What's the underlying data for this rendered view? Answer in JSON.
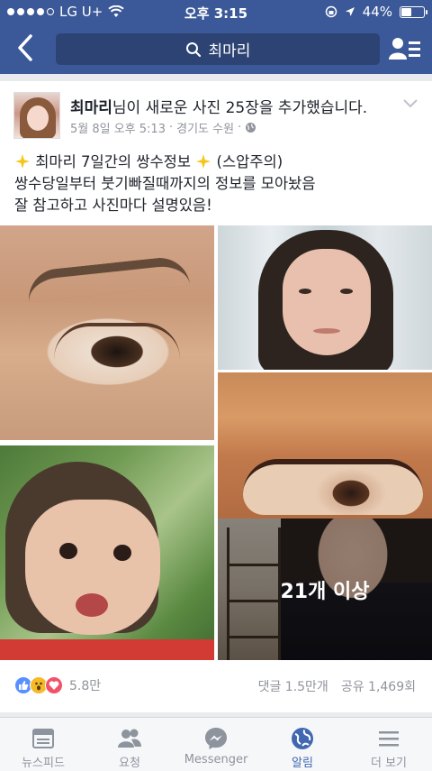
{
  "status_bar": {
    "carrier": "LG U+",
    "time": "오후 3:15",
    "battery": "44%",
    "battery_level": 0.44
  },
  "nav": {
    "search_text": "최마리"
  },
  "post": {
    "author": "최마리",
    "action": "님이 새로운 사진 25장을 추가했습니다.",
    "date": "5월 8일 오후 5:13",
    "location": "경기도 수원",
    "caption_line1_a": "최마리 7일간의 쌍수정보",
    "caption_line1_b": "(스압주의)",
    "caption_line2": "쌍수당일부터 붓기빠질때까지의 정보를 모아놨음",
    "caption_line3": "잘 참고하고 사진마다 설명있음!",
    "more_photos": "21개 이상",
    "reaction_count": "5.8만",
    "comments": "댓글 1.5만개",
    "shares": "공유 1,469회"
  },
  "tabs": [
    {
      "label": "뉴스피드",
      "icon": "news-feed-icon"
    },
    {
      "label": "요청",
      "icon": "friend-requests-icon"
    },
    {
      "label": "Messenger",
      "icon": "messenger-icon"
    },
    {
      "label": "알림",
      "icon": "globe-notifications-icon"
    },
    {
      "label": "더 보기",
      "icon": "hamburger-menu-icon"
    }
  ],
  "colors": {
    "brand": "#3b5998",
    "active_tab": "#4267b2",
    "meta_gray": "#90949c"
  }
}
